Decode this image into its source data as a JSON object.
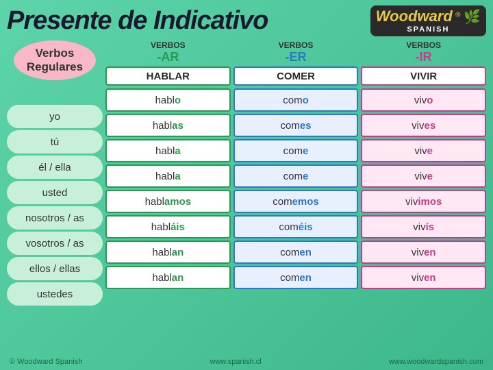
{
  "header": {
    "title": "Presente de Indicativo",
    "logo": {
      "brand": "Woodward",
      "reg": "®",
      "sub": "SPANISH"
    }
  },
  "pronouns": {
    "header": "Verbos\nRegulares",
    "items": [
      "yo",
      "tú",
      "él / ella",
      "usted",
      "nosotros / as",
      "vosotros / as",
      "ellos / ellas",
      "ustedes"
    ]
  },
  "columns": {
    "ar": {
      "label": "VERBOS",
      "suffix": "-AR",
      "verb": "HABLAR",
      "forms": [
        {
          "stem": "habl",
          "ending": "o"
        },
        {
          "stem": "habl",
          "ending": "as"
        },
        {
          "stem": "habl",
          "ending": "a"
        },
        {
          "stem": "habl",
          "ending": "a"
        },
        {
          "stem": "habl",
          "ending": "amos"
        },
        {
          "stem": "habl",
          "ending": "áis"
        },
        {
          "stem": "habl",
          "ending": "an"
        },
        {
          "stem": "habl",
          "ending": "an"
        }
      ]
    },
    "er": {
      "label": "VERBOS",
      "suffix": "-ER",
      "verb": "COMER",
      "forms": [
        {
          "stem": "com",
          "ending": "o"
        },
        {
          "stem": "com",
          "ending": "es"
        },
        {
          "stem": "com",
          "ending": "e"
        },
        {
          "stem": "com",
          "ending": "e"
        },
        {
          "stem": "com",
          "ending": "emos"
        },
        {
          "stem": "com",
          "ending": "éis"
        },
        {
          "stem": "com",
          "ending": "en"
        },
        {
          "stem": "com",
          "ending": "en"
        }
      ]
    },
    "ir": {
      "label": "VERBOS",
      "suffix": "-IR",
      "verb": "VIVIR",
      "forms": [
        {
          "stem": "viv",
          "ending": "o"
        },
        {
          "stem": "viv",
          "ending": "es"
        },
        {
          "stem": "viv",
          "ending": "e"
        },
        {
          "stem": "viv",
          "ending": "e"
        },
        {
          "stem": "viv",
          "ending": "imos"
        },
        {
          "stem": "viv",
          "ending": "ís"
        },
        {
          "stem": "viv",
          "ending": "en"
        },
        {
          "stem": "viv",
          "ending": "en"
        }
      ]
    }
  },
  "footer": {
    "left": "© Woodward Spanish",
    "center": "www.spanish.cl",
    "right": "www.woodwardspanish.com"
  }
}
